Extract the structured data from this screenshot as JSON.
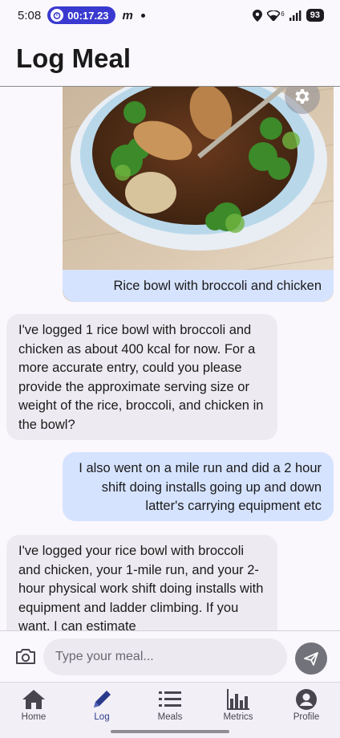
{
  "status_bar": {
    "time": "5:08",
    "timer": "00:17.23",
    "app_badge": "m",
    "network": "6",
    "battery": "93"
  },
  "header": {
    "title": "Log Meal"
  },
  "messages": [
    {
      "role": "user",
      "text": "Rice bowl with broccoli and chicken"
    },
    {
      "role": "assistant",
      "text": "I've logged 1 rice bowl with broccoli and chicken as about 400 kcal for now. For a more accurate entry, could you please provide the approximate serving size or weight of the rice, broccoli, and chicken in the bowl?"
    },
    {
      "role": "user",
      "text": "I also went on a mile run and did a 2 hour shift doing installs going up and down latter's carrying equipment etc"
    },
    {
      "role": "assistant",
      "text": "I've logged your rice bowl with broccoli and chicken, your 1-mile run, and your 2-hour physical work shift doing installs with equipment and ladder climbing. If you want, I can estimate"
    }
  ],
  "composer": {
    "placeholder": "Type your meal..."
  },
  "nav": {
    "items": [
      {
        "label": "Home",
        "icon": "home-icon"
      },
      {
        "label": "Log",
        "icon": "pencil-icon",
        "active": true
      },
      {
        "label": "Meals",
        "icon": "list-icon"
      },
      {
        "label": "Metrics",
        "icon": "bar-chart-icon"
      },
      {
        "label": "Profile",
        "icon": "account-circle-icon"
      }
    ]
  },
  "colors": {
    "user_bubble": "#d6e3ff",
    "bot_bubble": "#edebf1",
    "timer_pill": "#3a3ad0",
    "active_nav": "#2a3a8a"
  }
}
